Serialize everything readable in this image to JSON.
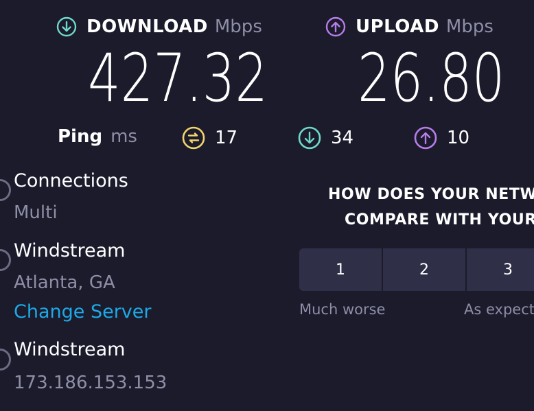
{
  "download": {
    "title": "DOWNLOAD",
    "unit": "Mbps",
    "value": "427.32",
    "icon": "arrow-down-circle-icon",
    "color": "#6fd9c8"
  },
  "upload": {
    "title": "UPLOAD",
    "unit": "Mbps",
    "value": "26.80",
    "icon": "arrow-up-circle-icon",
    "color": "#b77ee9"
  },
  "ping": {
    "label": "Ping",
    "unit": "ms",
    "idle": {
      "value": "17",
      "icon": "ping-icon",
      "color": "#f2d56b"
    },
    "download": {
      "value": "34",
      "icon": "arrow-down-circle-icon",
      "color": "#6fd9c8"
    },
    "upload": {
      "value": "10",
      "icon": "arrow-up-circle-icon",
      "color": "#b77ee9"
    }
  },
  "connections": {
    "title": "Connections",
    "value": "Multi"
  },
  "server": {
    "name": "Windstream",
    "location": "Atlanta, GA",
    "change_label": "Change Server"
  },
  "provider": {
    "name": "Windstream",
    "ip": "173.186.153.153"
  },
  "survey": {
    "line1": "HOW DOES YOUR NETW",
    "line2": "COMPARE WITH YOUR",
    "options": [
      "1",
      "2",
      "3"
    ],
    "low_label": "Much worse",
    "mid_label": "As expect"
  },
  "colors": {
    "background": "#1b1b2c",
    "link": "#1ea9e6",
    "muted": "#8e8ea6"
  }
}
